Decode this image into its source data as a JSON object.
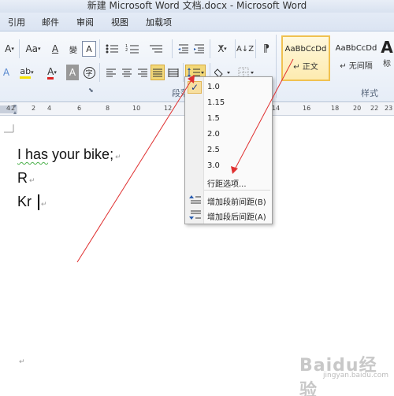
{
  "window": {
    "title": "新建 Microsoft Word 文档.docx - Microsoft Word"
  },
  "menu_tabs": [
    "引用",
    "邮件",
    "审阅",
    "视图",
    "加载项"
  ],
  "ribbon": {
    "font_group": {
      "font_size_grow": "A",
      "change_case": "Aa",
      "clear_format": "A",
      "text_effect": "A",
      "highlight": "ab",
      "font_color": "A",
      "char_shading": "A",
      "enclosed": "字"
    },
    "paragraph_group_label": "段落",
    "styles_group_label": "样式",
    "styles": [
      {
        "sample": "AaBbCcDd",
        "name": "↵ 正文",
        "selected": true
      },
      {
        "sample": "AaBbCcDd",
        "name": "↵ 无间隔",
        "selected": false
      },
      {
        "sample": "A",
        "name": "标",
        "selected": false
      }
    ]
  },
  "ruler": {
    "numbers": [
      "4",
      "2",
      "2",
      "4",
      "6",
      "8",
      "10",
      "12",
      "14",
      "16",
      "18",
      "20",
      "22",
      "23"
    ]
  },
  "document": {
    "lines": [
      "I has your bike;",
      "R",
      "Kr"
    ],
    "paragraph_mark": "↵"
  },
  "line_spacing_menu": {
    "options": [
      "1.0",
      "1.15",
      "1.5",
      "2.0",
      "2.5",
      "3.0"
    ],
    "checked": "1.0",
    "more": "行距选项...",
    "add_before": "增加段前间距(B)",
    "add_after": "增加段后间距(A)"
  },
  "watermark": {
    "logo": "Baidu经验",
    "url": "jingyan.baidu.com"
  },
  "colors": {
    "accent_highlight": "#f2d879",
    "arrow": "#e03030",
    "style_selected_border": "#f0c150"
  }
}
